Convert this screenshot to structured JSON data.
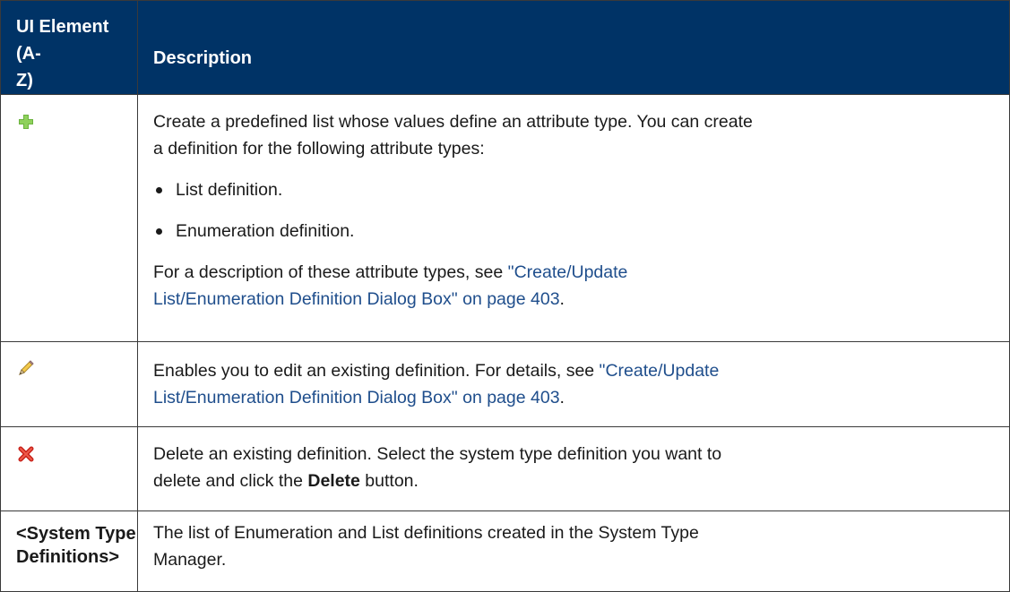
{
  "header": {
    "col1_line1": "UI Element (A-",
    "col1_line2": "Z)",
    "col2": "Description"
  },
  "rows": {
    "add": {
      "icon": "add-icon",
      "intro_line1": "Create a predefined list whose values define an attribute type. You can create",
      "intro_line2": "a definition for the following attribute types:",
      "bullets": [
        "List definition.",
        "Enumeration definition."
      ],
      "para_prefix": "For a description of these attribute types, see ",
      "link_line1": "\"Create/Update",
      "link_line2": "List/Enumeration Definition Dialog Box\" on page 403",
      "para_suffix": "."
    },
    "edit": {
      "icon": "pencil-icon",
      "text_prefix": "Enables you to edit an existing definition. For details, see ",
      "link_line1": "\"Create/Update",
      "link_line2": "List/Enumeration Definition Dialog Box\" on page 403",
      "text_suffix": "."
    },
    "delete": {
      "icon": "delete-icon",
      "line1": "Delete an existing definition. Select the system type definition you want to",
      "line2_prefix": "delete and click the ",
      "line2_bold": "Delete",
      "line2_suffix": " button."
    },
    "definitions": {
      "label_line1": "<System Type",
      "label_line2": "Definitions>",
      "line1": "The list of Enumeration and List definitions created in the System Type",
      "line2": "Manager."
    }
  },
  "colors": {
    "header_bg": "#003366",
    "link": "#1f4e8c",
    "add_icon": "#5aa02c",
    "delete_icon": "#d62a1e"
  }
}
